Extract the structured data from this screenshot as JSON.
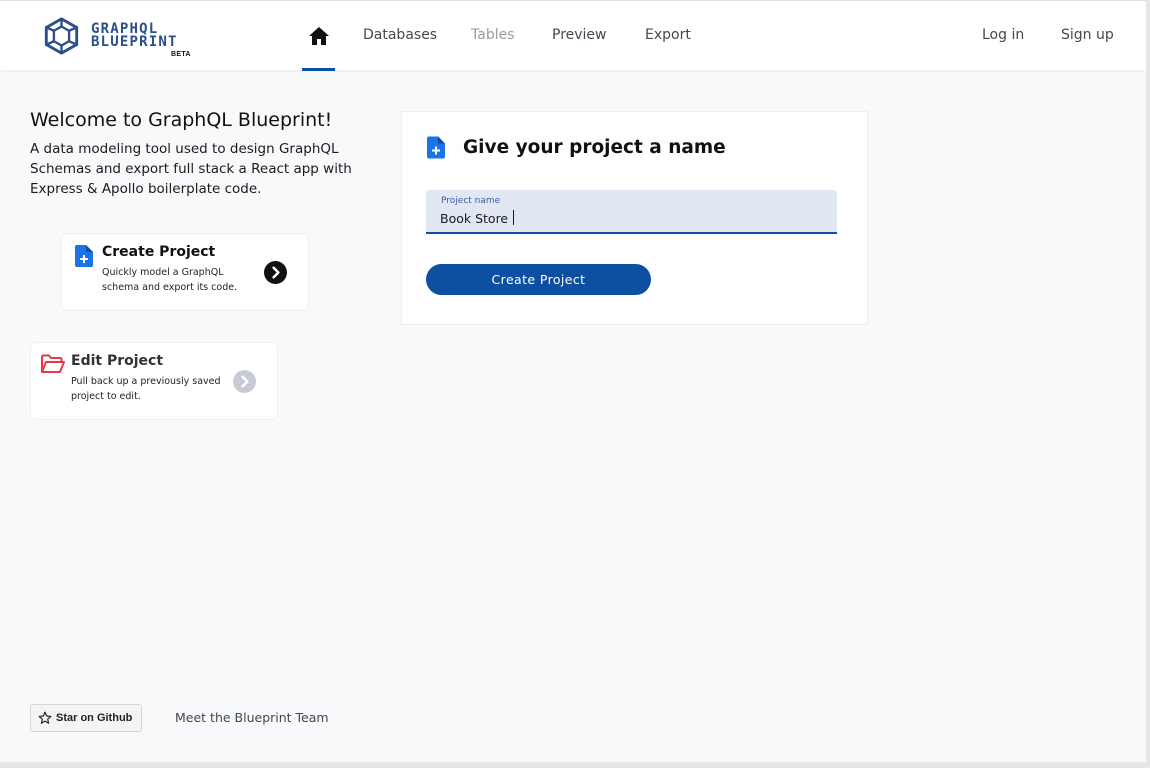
{
  "brand": {
    "line1": "GRAPHQL",
    "line2": "BLUEPRINT",
    "badge": "BETA",
    "color": "#2a4f8a"
  },
  "nav": {
    "home_icon": "home-icon",
    "links": [
      {
        "label": "Databases",
        "state": "enabled"
      },
      {
        "label": "Tables",
        "state": "disabled"
      },
      {
        "label": "Preview",
        "state": "enabled"
      },
      {
        "label": "Export",
        "state": "enabled"
      }
    ],
    "login": "Log in",
    "signup": "Sign up",
    "active_color": "#0d4fa0"
  },
  "welcome": {
    "title": "Welcome to GraphQL Blueprint!",
    "description": "A data modeling tool used to design GraphQL Schemas and export full stack a React app with Express & Apollo boilerplate code."
  },
  "cards": {
    "create": {
      "icon": "file-plus-icon",
      "title": "Create Project",
      "description": "Quickly model a GraphQL schema and export its code.",
      "arrow_icon": "chevron-right-icon"
    },
    "edit": {
      "icon": "folder-open-icon",
      "title": "Edit Project",
      "description": "Pull back up a previously saved project to edit.",
      "arrow_icon": "chevron-right-icon"
    }
  },
  "project_form": {
    "icon": "file-plus-icon",
    "title": "Give your project a name",
    "field_label": "Project name",
    "field_value": "Book Store",
    "submit_label": "Create Project",
    "accent": "#0d4fa0"
  },
  "footer": {
    "github_label": "Star on Github",
    "team_link": "Meet the Blueprint Team"
  }
}
